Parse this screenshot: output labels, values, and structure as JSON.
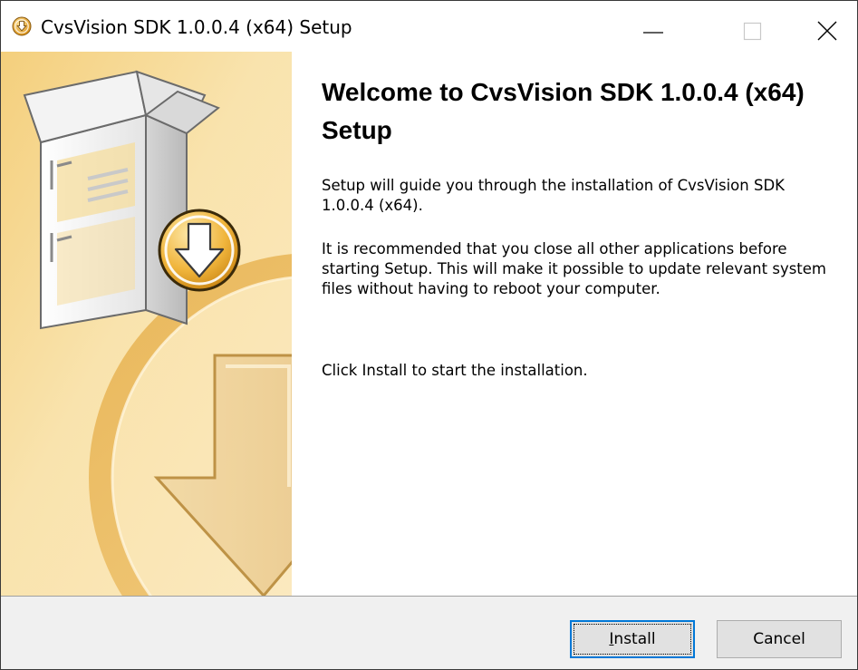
{
  "window": {
    "title": "CvsVision SDK 1.0.0.4 (x64) Setup",
    "controls": [
      "minimize",
      "maximize",
      "close"
    ]
  },
  "banner": {
    "icons": [
      "software-box-icon",
      "download-arrow-icon"
    ],
    "colors": {
      "light": "#fdf1cf",
      "dark": "#f0c36a",
      "accent": "#e8a21a"
    }
  },
  "welcome": {
    "heading": "Welcome to CvsVision SDK 1.0.0.4 (x64) Setup",
    "paragraph1": "Setup will guide you through the installation of CvsVision SDK 1.0.0.4 (x64).",
    "paragraph2": "It is recommended that you close all other applications before starting Setup. This will make it possible to update relevant system files without having to reboot your computer.",
    "paragraph3": "Click Install to start the installation."
  },
  "buttons": {
    "install_mnemonic": "I",
    "install_rest": "nstall",
    "cancel": "Cancel"
  },
  "colors": {
    "focus_border": "#0078d7",
    "footer_bg": "#f0f0f0",
    "button_bg": "#e1e1e1"
  }
}
